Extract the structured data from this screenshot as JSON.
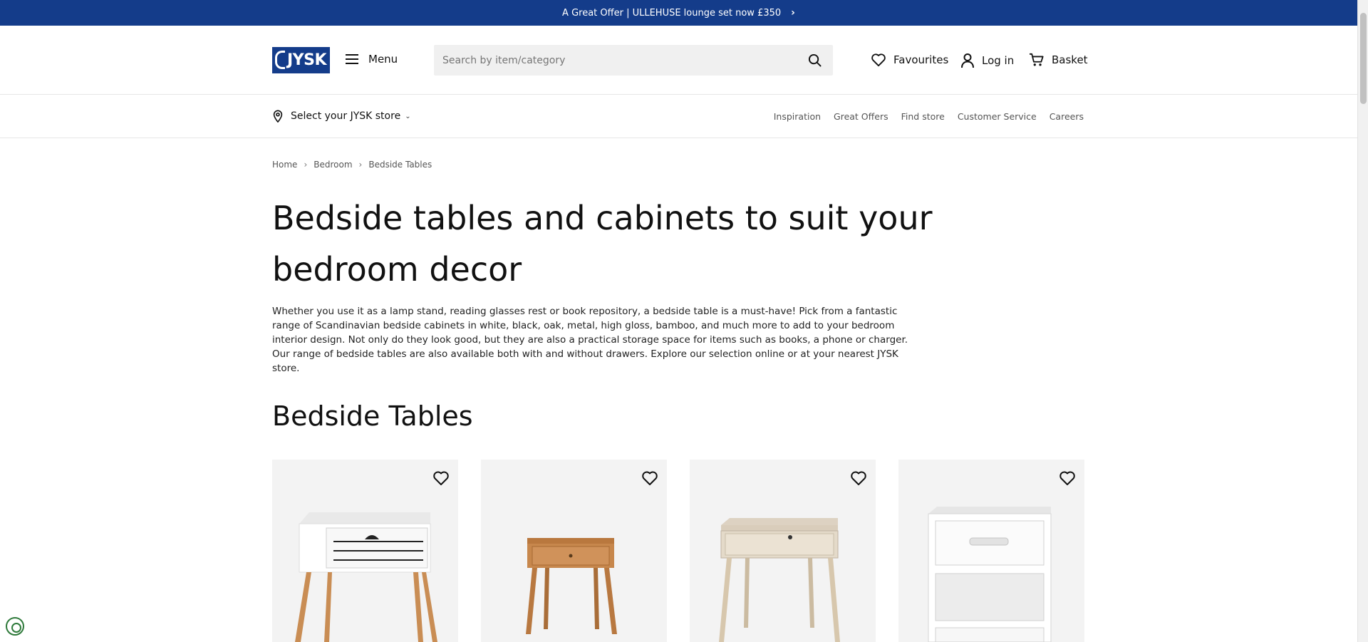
{
  "promo": {
    "text": "A Great Offer | ULLEHUSE lounge set now £350",
    "chevron": "›"
  },
  "header": {
    "logo": "JYSK",
    "menu_label": "Menu",
    "search_placeholder": "Search by item/category",
    "favourites_label": "Favourites",
    "login_label": "Log in",
    "basket_label": "Basket"
  },
  "subnav": {
    "store_label": "Select your JYSK store",
    "links": [
      "Inspiration",
      "Great Offers",
      "Find store",
      "Customer Service",
      "Careers"
    ]
  },
  "breadcrumb": [
    "Home",
    "Bedroom",
    "Bedside Tables"
  ],
  "page": {
    "title": "Bedside tables and cabinets to suit your bedroom decor",
    "intro": "Whether you use it as a lamp stand, reading glasses rest or book repository, a bedside table is a must-have! Pick from a fantastic range of Scandinavian bedside cabinets in white, black, oak, metal, high gloss, bamboo, and much more to add to your bedroom interior design. Not only do they look good, but they are also a practical storage space for items such as books, a phone or charger. Our range of bedside tables are also available both with and without drawers. Explore our selection online or at your nearest JYSK store.",
    "section_title": "Bedside Tables"
  },
  "colors": {
    "brand": "#143c8a",
    "card_bg": "#f3f3f3"
  },
  "icons": {
    "banner": "chevron-right-icon",
    "menu": "hamburger-icon",
    "search": "search-icon",
    "favourites": "heart-icon",
    "login": "user-icon",
    "basket": "cart-icon",
    "store": "location-pin-icon"
  }
}
